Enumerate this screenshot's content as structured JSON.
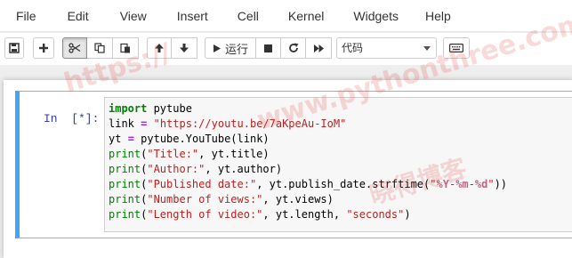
{
  "menu": {
    "items": [
      "File",
      "Edit",
      "View",
      "Insert",
      "Cell",
      "Kernel",
      "Widgets",
      "Help"
    ]
  },
  "toolbar": {
    "run_label": "运行",
    "cell_type": "代码",
    "icons": {
      "save": "save-icon",
      "insert": "plus-icon",
      "cut": "scissors-icon",
      "copy": "copy-icon",
      "paste": "paste-icon",
      "move_up": "arrow-up-icon",
      "move_down": "arrow-down-icon",
      "run": "play-icon",
      "interrupt": "stop-icon",
      "restart": "restart-icon",
      "run_all": "fast-forward-icon",
      "command_palette": "keyboard-icon"
    }
  },
  "cell": {
    "prompt": "In  [*]:",
    "accent_color": "#42a5f5",
    "lines": [
      {
        "tokens": [
          {
            "t": "import",
            "c": "kw"
          },
          {
            "t": " pytube",
            "c": ""
          }
        ]
      },
      {
        "tokens": [
          {
            "t": "link ",
            "c": ""
          },
          {
            "t": "=",
            "c": "op"
          },
          {
            "t": " ",
            "c": ""
          },
          {
            "t": "\"https://youtu.be/7aKpeAu-IoM\"",
            "c": "str"
          }
        ]
      },
      {
        "tokens": [
          {
            "t": "yt ",
            "c": ""
          },
          {
            "t": "=",
            "c": "op"
          },
          {
            "t": " pytube.YouTube(link)",
            "c": ""
          }
        ]
      },
      {
        "tokens": [
          {
            "t": "print",
            "c": "bi"
          },
          {
            "t": "(",
            "c": ""
          },
          {
            "t": "\"Title:\"",
            "c": "str"
          },
          {
            "t": ", yt.title)",
            "c": ""
          }
        ]
      },
      {
        "tokens": [
          {
            "t": "print",
            "c": "bi"
          },
          {
            "t": "(",
            "c": ""
          },
          {
            "t": "\"Author:\"",
            "c": "str"
          },
          {
            "t": ", yt.author)",
            "c": ""
          }
        ]
      },
      {
        "tokens": [
          {
            "t": "print",
            "c": "bi"
          },
          {
            "t": "(",
            "c": ""
          },
          {
            "t": "\"Published date:\"",
            "c": "str"
          },
          {
            "t": ", yt.publish_date.strftime(",
            "c": ""
          },
          {
            "t": "\"",
            "c": "str"
          },
          {
            "t": "%Y",
            "c": "fmt"
          },
          {
            "t": "-",
            "c": "str"
          },
          {
            "t": "%m",
            "c": "fmt"
          },
          {
            "t": "-",
            "c": "str"
          },
          {
            "t": "%d",
            "c": "fmt"
          },
          {
            "t": "\"",
            "c": "str"
          },
          {
            "t": "))",
            "c": ""
          }
        ]
      },
      {
        "tokens": [
          {
            "t": "print",
            "c": "bi"
          },
          {
            "t": "(",
            "c": ""
          },
          {
            "t": "\"Number of views:\"",
            "c": "str"
          },
          {
            "t": ", yt.views)",
            "c": ""
          }
        ]
      },
      {
        "tokens": [
          {
            "t": "print",
            "c": "bi"
          },
          {
            "t": "(",
            "c": ""
          },
          {
            "t": "\"Length of video:\"",
            "c": "str"
          },
          {
            "t": ", yt.length, ",
            "c": ""
          },
          {
            "t": "\"seconds\"",
            "c": "str"
          },
          {
            "t": ")",
            "c": ""
          }
        ]
      }
    ]
  },
  "watermark": {
    "url_part1": "https://",
    "url_part2": "www.pythonthree.com",
    "cn_text": "晓得博客"
  }
}
